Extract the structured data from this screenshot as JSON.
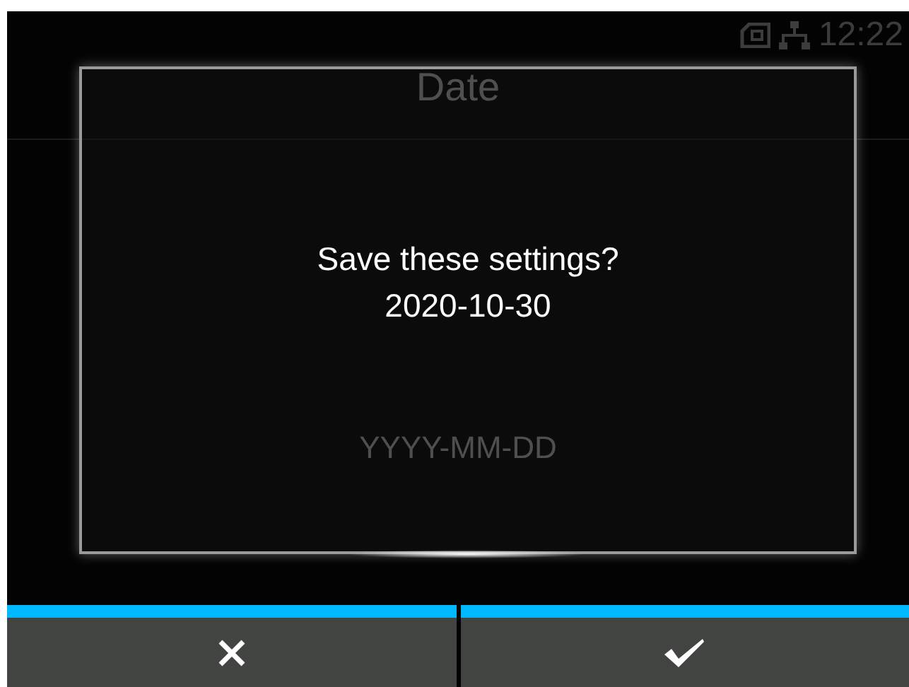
{
  "status_bar": {
    "time": "12:22"
  },
  "screen": {
    "title": "Date",
    "format_hint": "YYYY-MM-DD"
  },
  "dialog": {
    "message": "Save these settings?",
    "value": "2020-10-30"
  },
  "buttons": [
    {
      "kind": "cancel"
    },
    {
      "kind": "confirm"
    }
  ]
}
